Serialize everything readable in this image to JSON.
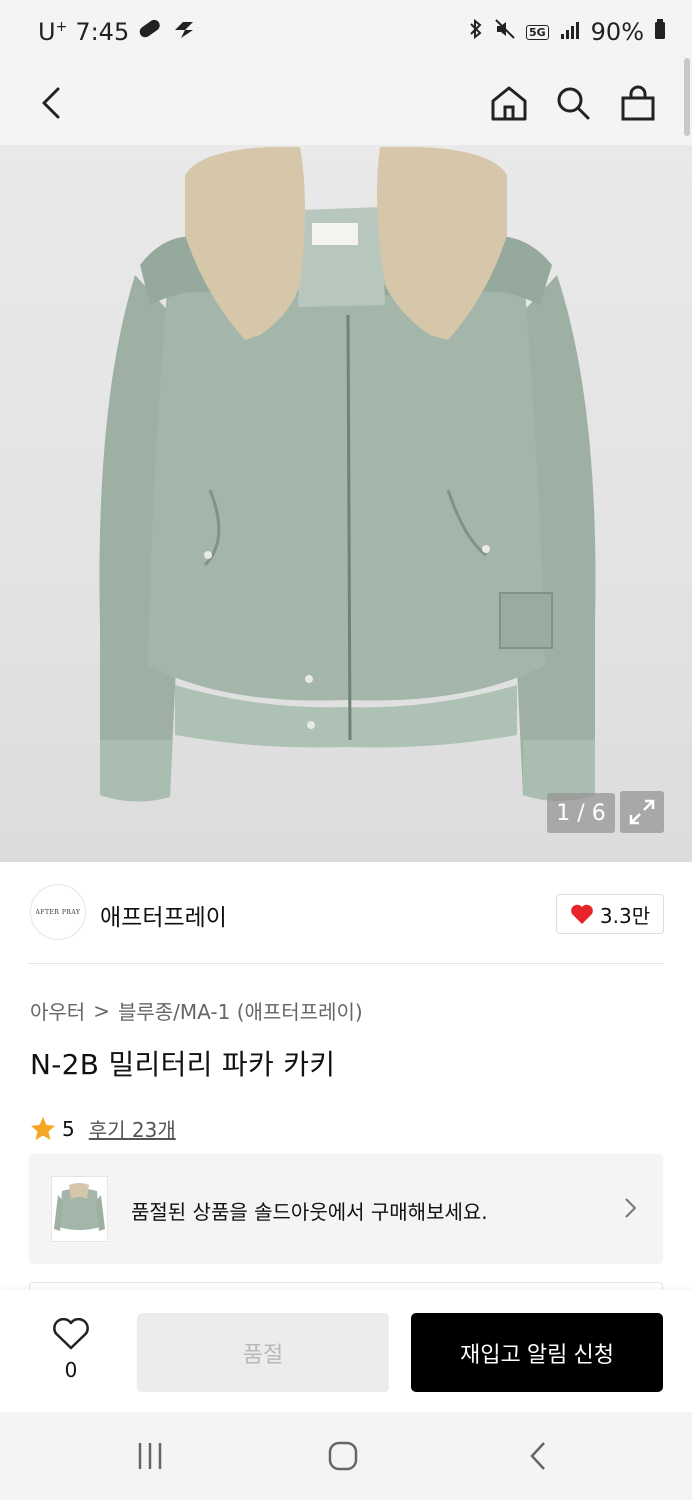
{
  "status_bar": {
    "carrier": "U",
    "carrier_sup": "+",
    "time": "7:45",
    "network": "5G",
    "battery": "90%"
  },
  "header": {
    "back_icon": "chevron-left-icon",
    "home_icon": "home-icon",
    "search_icon": "search-icon",
    "bag_icon": "shopping-bag-icon"
  },
  "gallery": {
    "pager": "1 / 6",
    "expand_icon": "expand-icon"
  },
  "brand": {
    "logo_text": "AFTER PRAY",
    "name": "애프터프레이",
    "like_count": "3.3만"
  },
  "product": {
    "breadcrumb_category": "아우터",
    "breadcrumb_separator": ">",
    "breadcrumb_sub": "블루종/MA-1 (애프터프레이)",
    "title": "N-2B 밀리터리 파카 카키",
    "rating": "5",
    "reviews": "후기 23개"
  },
  "soldout_banner": {
    "text": "품절된 상품을 솔드아웃에서 구매해보세요."
  },
  "bottom_bar": {
    "wish_count": "0",
    "soldout_label": "품절",
    "restock_label": "재입고 알림 신청"
  },
  "colors": {
    "accent_heart": "#e8242b",
    "star": "#f5a623",
    "jacket": "#9fb3a6",
    "fur": "#d8c9ae"
  }
}
